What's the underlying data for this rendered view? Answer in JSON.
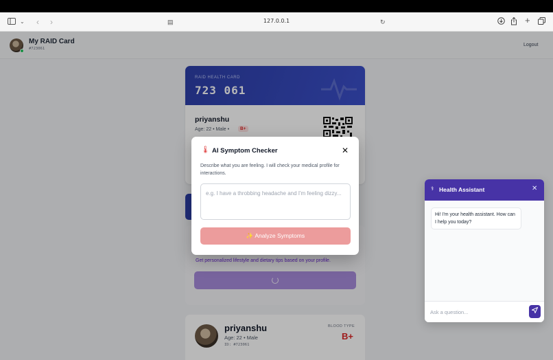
{
  "browser": {
    "url": "127.0.0.1",
    "icons": [
      "sidebar-icon",
      "chevron-down-icon",
      "back-icon",
      "forward-icon",
      "page-settings-icon",
      "reload-icon",
      "download-icon",
      "share-icon",
      "new-tab-icon",
      "tabs-overview-icon"
    ]
  },
  "app": {
    "title": "My RAID Card",
    "id": "#723061",
    "logout": "Logout"
  },
  "card": {
    "label": "RAID HEALTH CARD",
    "number": "723 061",
    "name": "priyanshu",
    "age": "Age: 22 • Male •",
    "blood": "B+"
  },
  "lifestyle": {
    "desc": "Get personalized lifestyle and dietary tips based on your profile."
  },
  "profile": {
    "name": "priyanshu",
    "age": "Age: 22 • Male",
    "id": "ID: #723061",
    "blood_label": "BLOOD TYPE",
    "blood": "B+"
  },
  "modal": {
    "title": "AI Symptom Checker",
    "desc": "Describe what you are feeling. I will check your medical profile for interactions.",
    "placeholder": "e.g. I have a throbbing headache and I'm feeling dizzy...",
    "button": "✨ Analyze Symptoms",
    "close": "✕"
  },
  "chat": {
    "title": "Health Assistant",
    "close": "✕",
    "greeting": "Hi! I'm your health assistant. How can I help you today?",
    "placeholder": "Ask a question..."
  },
  "colors": {
    "brand_blue": "#2d3fa8",
    "assistant_purple": "#4733a6",
    "danger": "#dc2626",
    "analyze_button": "#ec9c9c"
  }
}
